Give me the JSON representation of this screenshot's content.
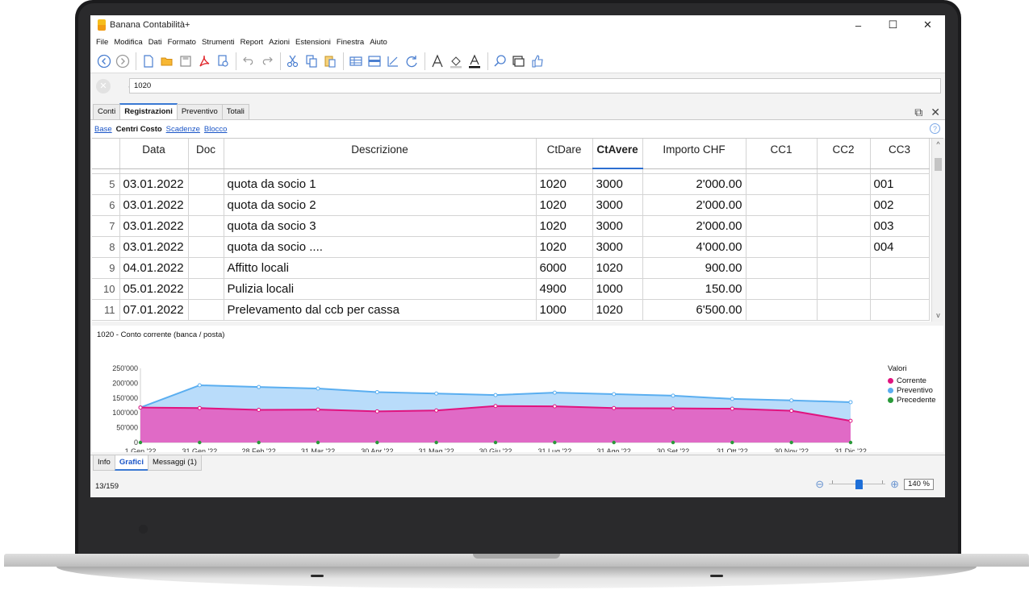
{
  "window": {
    "title": "Banana Contabilità+",
    "controls": [
      "–",
      "☐",
      "✕"
    ]
  },
  "menu": [
    "File",
    "Modifica",
    "Dati",
    "Formato",
    "Strumenti",
    "Report",
    "Azioni",
    "Estensioni",
    "Finestra",
    "Aiuto"
  ],
  "toolbar": {
    "icons": [
      "back-icon",
      "forward-icon",
      "new-file-icon",
      "open-folder-icon",
      "save-icon",
      "pdf-icon",
      "print-preview-icon",
      "undo-icon",
      "redo-icon",
      "cut-icon",
      "copy-icon",
      "paste-icon",
      "add-row-icon",
      "insert-row-icon",
      "edit-chart-icon",
      "refresh-icon",
      "font-icon",
      "fill-color-icon",
      "text-color-icon",
      "search-icon",
      "view-dropdown-icon",
      "like-icon"
    ]
  },
  "edit_bar": {
    "value": "1020"
  },
  "tabs": [
    "Conti",
    "Registrazioni",
    "Preventivo",
    "Totali"
  ],
  "active_tab": "Registrazioni",
  "subviews": [
    "Base",
    "Centri Costo",
    "Scadenze",
    "Blocco"
  ],
  "active_subview": "Centri Costo",
  "table": {
    "columns": [
      "",
      "Data",
      "Doc",
      "Descrizione",
      "CtDare",
      "CtAvere",
      "Importo CHF",
      "CC1",
      "CC2",
      "CC3"
    ],
    "rows": [
      [
        "5",
        "03.01.2022",
        "",
        "quota da socio 1",
        "1020",
        "3000",
        "2'000.00",
        "",
        "",
        "001"
      ],
      [
        "6",
        "03.01.2022",
        "",
        "quota da socio 2",
        "1020",
        "3000",
        "2'000.00",
        "",
        "",
        "002"
      ],
      [
        "7",
        "03.01.2022",
        "",
        "quota da socio 3",
        "1020",
        "3000",
        "2'000.00",
        "",
        "",
        "003"
      ],
      [
        "8",
        "03.01.2022",
        "",
        "quota da socio ....",
        "1020",
        "3000",
        "4'000.00",
        "",
        "",
        "004"
      ],
      [
        "9",
        "04.01.2022",
        "",
        "Affitto locali",
        "6000",
        "1020",
        "900.00",
        "",
        "",
        ""
      ],
      [
        "10",
        "05.01.2022",
        "",
        "Pulizia locali",
        "4900",
        "1000",
        "150.00",
        "",
        "",
        ""
      ],
      [
        "11",
        "07.01.2022",
        "",
        "Prelevamento dal ccb per cassa",
        "1000",
        "1020",
        "6'500.00",
        "",
        "",
        ""
      ]
    ]
  },
  "chart_data": {
    "type": "area",
    "title": "1020 - Conto corrente (banca / posta)",
    "categories": [
      "1 Gen '22",
      "31 Gen '22",
      "28 Feb '22",
      "31 Mar '22",
      "30 Apr '22",
      "31 Mag '22",
      "30 Giu '22",
      "31 Lug '22",
      "31 Ago '22",
      "30 Set '22",
      "31 Ott '22",
      "30 Nov '22",
      "31 Dic '22"
    ],
    "yticks": [
      "250'000",
      "200'000",
      "150'000",
      "100'000",
      "50'000",
      "0"
    ],
    "ylim": [
      0,
      250000
    ],
    "legend_title": "Valori",
    "legend_position": "right",
    "series": [
      {
        "name": "Corrente",
        "color": "#e0147f",
        "values": [
          118000,
          116000,
          110000,
          111000,
          105000,
          108000,
          123000,
          122000,
          116000,
          115000,
          114000,
          107000,
          73000
        ]
      },
      {
        "name": "Preventivo",
        "color": "#5aaef0",
        "values": [
          118000,
          193000,
          187000,
          182000,
          170000,
          165000,
          160000,
          168000,
          163000,
          158000,
          147000,
          142000,
          136000
        ]
      },
      {
        "name": "Precedente",
        "color": "#2a9a3a",
        "values": [
          0,
          0,
          0,
          0,
          0,
          0,
          0,
          0,
          0,
          0,
          0,
          0,
          0
        ]
      }
    ]
  },
  "bottom_tabs": [
    "Info",
    "Grafici",
    "Messaggi (1)"
  ],
  "active_bottom_tab": "Grafici",
  "status": {
    "position": "13/159",
    "zoom": "140 %"
  }
}
